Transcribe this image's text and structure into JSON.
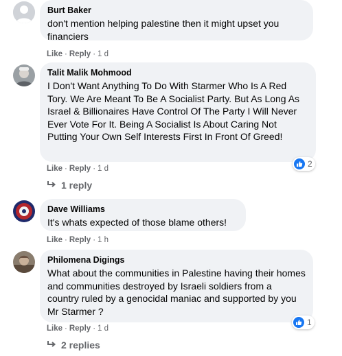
{
  "actions": {
    "like": "Like",
    "reply": "Reply",
    "separator": "·"
  },
  "comments": [
    {
      "author": "Burt Baker",
      "text": "don't mention helping palestine then it might upset you financiers",
      "time": "1 d"
    },
    {
      "author": "Talit Malik Mohmood",
      "text": "I Don't Want Anything To Do With Starmer Who Is A Red Tory. We Are Meant To Be A Socialist Party. But As Long As Israel & Billionaires Have Control Of The Party I Will Never Ever Vote For It. Being A Socialist Is About Caring Not Putting Your Own Self Interests First In Front Of Greed!",
      "time": "1 d",
      "reactions": "2",
      "replies": "1 reply"
    },
    {
      "author": "Dave Williams",
      "text": "It's whats expected of those blame others!",
      "time": "1 h"
    },
    {
      "author": "Philomena Digings",
      "text": "What about the communities in Palestine having their homes and communities destroyed by Israeli soldiers from a country ruled by a genocidal maniac and supported by you Mr Starmer ?",
      "time": "1 d",
      "reactions": "1",
      "replies": "2 replies"
    }
  ],
  "colors": {
    "bubble": "#f0f2f5",
    "secondary_text": "#65676b",
    "like_blue": "#1877f2"
  }
}
